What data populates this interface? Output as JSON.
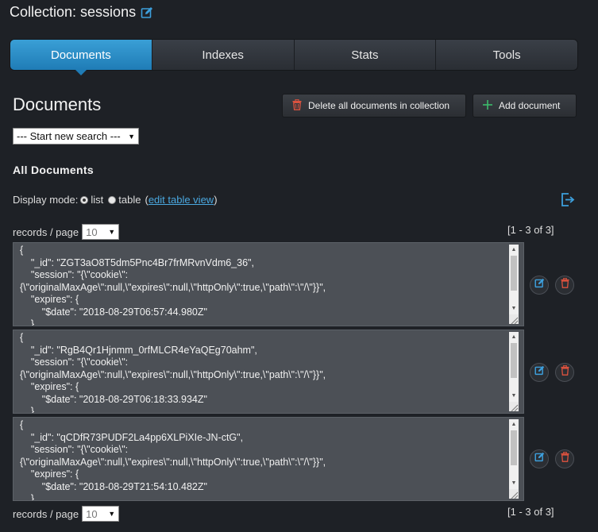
{
  "header": {
    "title": "Collection: sessions",
    "edit_icon": "pencil-square-icon"
  },
  "tabs": [
    {
      "label": "Documents",
      "active": true
    },
    {
      "label": "Indexes",
      "active": false
    },
    {
      "label": "Stats",
      "active": false
    },
    {
      "label": "Tools",
      "active": false
    }
  ],
  "section": {
    "heading": "Documents",
    "delete_all_label": "Delete all documents in collection",
    "add_label": "Add document",
    "search_select": "--- Start new search ---",
    "all_docs_heading": "All Documents"
  },
  "display_mode": {
    "label": "Display mode:",
    "list_label": "list",
    "table_label": "table",
    "open_paren": "(",
    "edit_link": "edit table view",
    "close_paren": ")",
    "selected": "list"
  },
  "pagination": {
    "records_label": "records / page",
    "records_value": "10",
    "range": "[1 - 3 of 3]"
  },
  "documents": [
    {
      "text": "{\n    \"_id\": \"ZGT3aO8T5dm5Pnc4Br7frMRvnVdm6_36\",\n    \"session\": \"{\\\"cookie\\\":\n{\\\"originalMaxAge\\\":null,\\\"expires\\\":null,\\\"httpOnly\\\":true,\\\"path\\\":\\\"/\\\"}}\",\n    \"expires\": {\n        \"$date\": \"2018-08-29T06:57:44.980Z\"\n    }"
    },
    {
      "text": "{\n    \"_id\": \"RgB4Qr1Hjnmm_0rfMLCR4eYaQEg70ahm\",\n    \"session\": \"{\\\"cookie\\\":\n{\\\"originalMaxAge\\\":null,\\\"expires\\\":null,\\\"httpOnly\\\":true,\\\"path\\\":\\\"/\\\"}}\",\n    \"expires\": {\n        \"$date\": \"2018-08-29T06:18:33.934Z\"\n    }"
    },
    {
      "text": "{\n    \"_id\": \"qCDfR73PUDF2La4pp6XLPiXIe-JN-ctG\",\n    \"session\": \"{\\\"cookie\\\":\n{\\\"originalMaxAge\\\":null,\\\"expires\\\":null,\\\"httpOnly\\\":true,\\\"path\\\":\\\"/\\\"}}\",\n    \"expires\": {\n        \"$date\": \"2018-08-29T21:54:10.482Z\"\n    }"
    }
  ],
  "colors": {
    "accent": "#2a8fcc",
    "delete": "#e0533f",
    "add": "#3dbb6b",
    "edit": "#3d9fdc"
  }
}
